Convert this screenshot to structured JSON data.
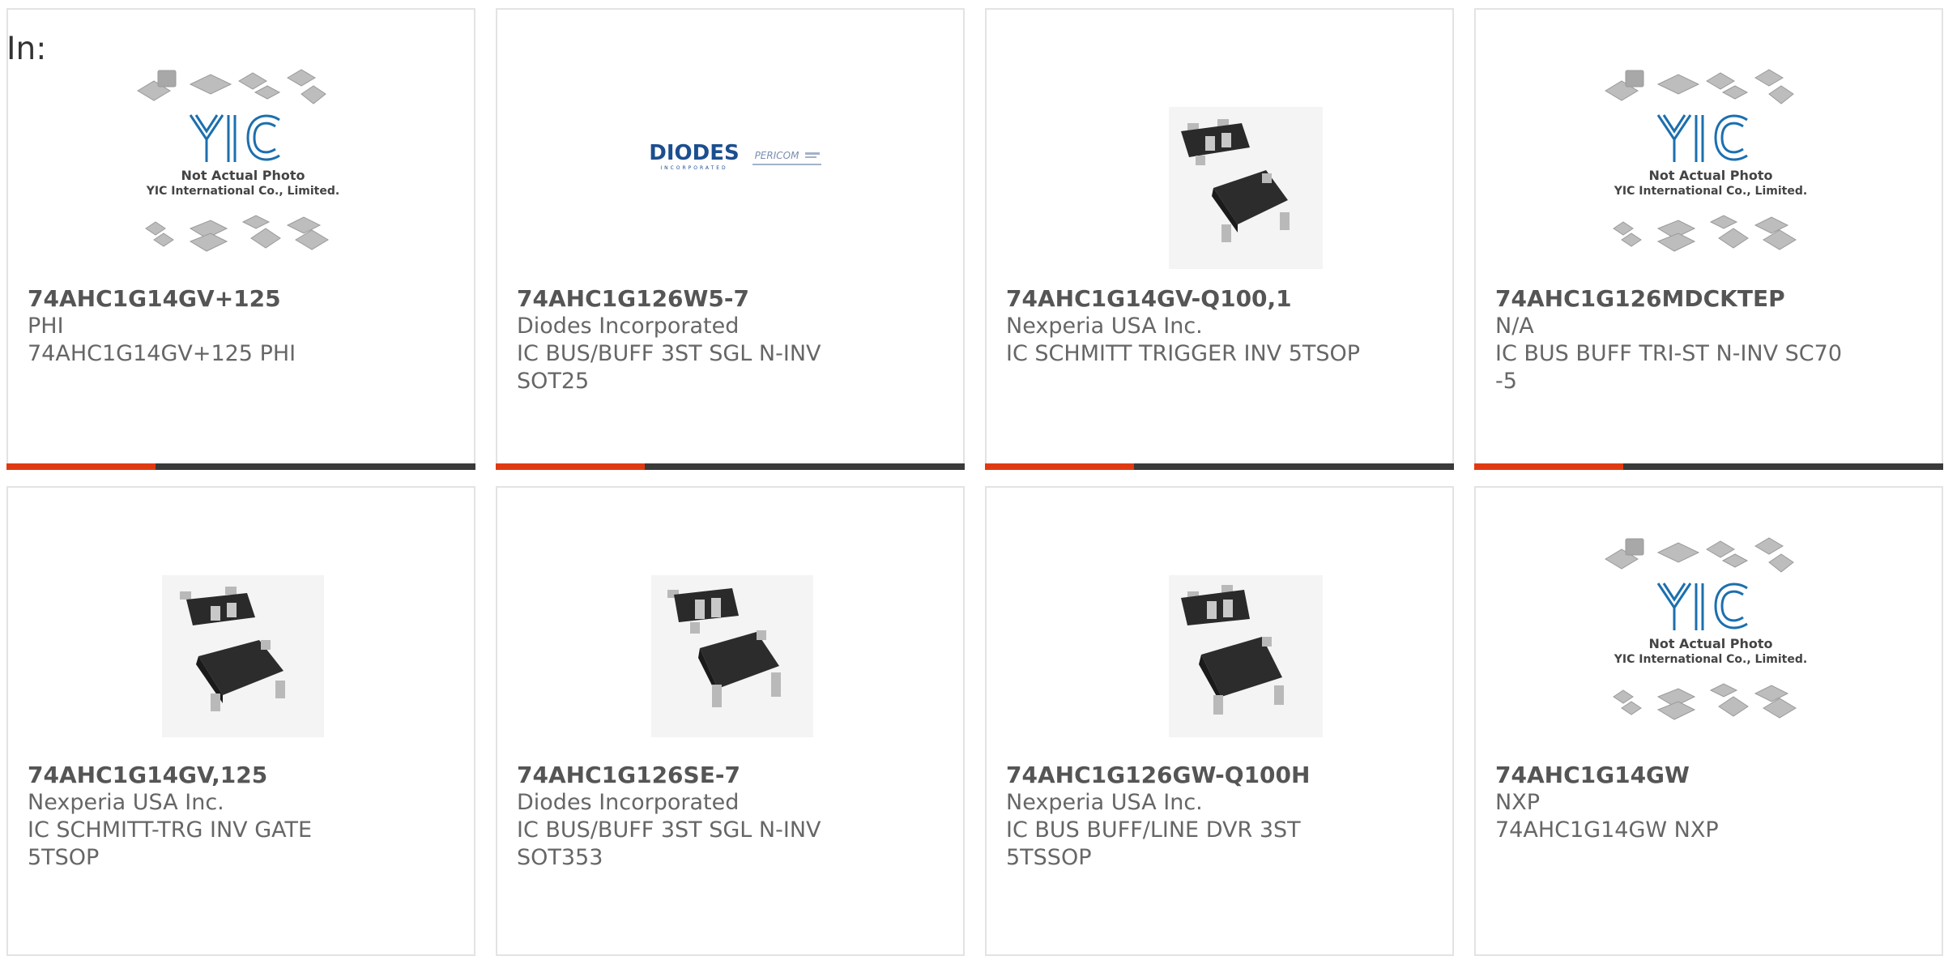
{
  "page": {
    "label": "In:"
  },
  "colors": {
    "accent": "#e03a12",
    "bar": "#3a3a3a",
    "border": "#e3e3e3",
    "text": "#555555",
    "yic_blue": "#1c6fae"
  },
  "placeholder": {
    "brand": "YIC",
    "line1": "Not Actual Photo",
    "line2": "YIC International Co., Limited."
  },
  "diodes_logo": {
    "brand": "DIODES",
    "sub": "INCORPORATED",
    "partner": "PERICOM"
  },
  "products": [
    {
      "part": "74AHC1G14GV+125",
      "manufacturer": "PHI",
      "description": "74AHC1G14GV+125 PHI",
      "image": "placeholder-icon"
    },
    {
      "part": "74AHC1G126W5-7",
      "manufacturer": "Diodes Incorporated",
      "description": "IC BUS/BUFF 3ST SGL N-INV SOT25",
      "image": "diodes-logo-icon"
    },
    {
      "part": "74AHC1G14GV-Q100,1",
      "manufacturer": "Nexperia USA Inc.",
      "description": "IC SCHMITT TRIGGER INV 5TSOP",
      "image": "chip-package-icon"
    },
    {
      "part": "74AHC1G126MDCKTEP",
      "manufacturer": "N/A",
      "description": "IC BUS BUFF TRI-ST N-INV SC70-5",
      "image": "placeholder-icon"
    },
    {
      "part": "74AHC1G14GV,125",
      "manufacturer": "Nexperia USA Inc.",
      "description": "IC SCHMITT-TRG INV GATE 5TSOP",
      "image": "chip-package-icon"
    },
    {
      "part": "74AHC1G126SE-7",
      "manufacturer": "Diodes Incorporated",
      "description": "IC BUS/BUFF 3ST SGL N-INV SOT353",
      "image": "chip-package-icon"
    },
    {
      "part": "74AHC1G126GW-Q100H",
      "manufacturer": "Nexperia USA Inc.",
      "description": "IC BUS BUFF/LINE DVR 3ST 5TSSOP",
      "image": "chip-package-icon"
    },
    {
      "part": "74AHC1G14GW",
      "manufacturer": "NXP",
      "description": "74AHC1G14GW NXP",
      "image": "placeholder-icon"
    }
  ]
}
